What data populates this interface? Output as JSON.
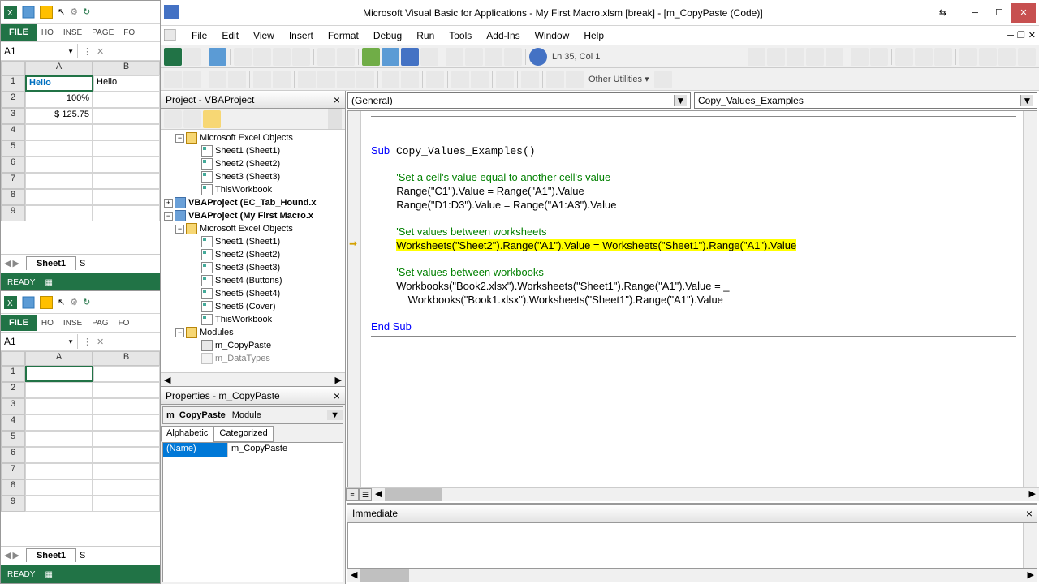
{
  "excel1": {
    "file_tab": "FILE",
    "ribbon_tabs": [
      "HO",
      "INSE",
      "PAGE",
      "FO"
    ],
    "name_box": "A1",
    "cols": [
      "A",
      "B"
    ],
    "b1": "Hello",
    "rows": {
      "1": "Hello",
      "2": "100%",
      "3": "$ 125.75"
    },
    "sheet": "Sheet1",
    "sheet2_partial": "S",
    "status": "READY"
  },
  "excel2": {
    "file_tab": "FILE",
    "ribbon_tabs": [
      "HO",
      "INSE",
      "PAG",
      "FO"
    ],
    "name_box": "A1",
    "cols": [
      "A",
      "B"
    ],
    "sheet": "Sheet1",
    "sheet2_partial": "S",
    "status": "READY"
  },
  "vbe": {
    "title": "Microsoft Visual Basic for Applications - My First Macro.xlsm [break] - [m_CopyPaste (Code)]",
    "menus": [
      "File",
      "Edit",
      "View",
      "Insert",
      "Format",
      "Debug",
      "Run",
      "Tools",
      "Add-Ins",
      "Window",
      "Help"
    ],
    "cursor_pos": "Ln 35, Col 1",
    "other_utils": "Other Utilities",
    "project": {
      "title": "Project - VBAProject",
      "nodes": {
        "meo1": "Microsoft Excel Objects",
        "s1": "Sheet1 (Sheet1)",
        "s2": "Sheet2 (Sheet2)",
        "s3": "Sheet3 (Sheet3)",
        "tw": "ThisWorkbook",
        "proj1": "VBAProject (EC_Tab_Hound.x",
        "proj2": "VBAProject (My First Macro.x",
        "meo2": "Microsoft Excel Objects",
        "p2s1": "Sheet1 (Sheet1)",
        "p2s2": "Sheet2 (Sheet2)",
        "p2s3": "Sheet3 (Sheet3)",
        "p2s4": "Sheet4 (Buttons)",
        "p2s5": "Sheet5 (Sheet4)",
        "p2s6": "Sheet6 (Cover)",
        "p2tw": "ThisWorkbook",
        "modules": "Modules",
        "mod1": "m_CopyPaste",
        "mod2": "m_DataTypes"
      }
    },
    "properties": {
      "title": "Properties - m_CopyPaste",
      "combo_name": "m_CopyPaste",
      "combo_type": "Module",
      "tab_alpha": "Alphabetic",
      "tab_cat": "Categorized",
      "row_name": "(Name)",
      "row_value": "m_CopyPaste"
    },
    "code": {
      "dd_left": "(General)",
      "dd_right": "Copy_Values_Examples",
      "sub_line": "Sub Copy_Values_Examples()",
      "c1": "'Set a cell's value equal to another cell's value",
      "l1": "Range(\"C1\").Value = Range(\"A1\").Value",
      "l2": "Range(\"D1:D3\").Value = Range(\"A1:A3\").Value",
      "c2": "'Set values between worksheets",
      "hl": "Worksheets(\"Sheet2\").Range(\"A1\").Value = Worksheets(\"Sheet1\").Range(\"A1\").Value",
      "c3": "'Set values between workbooks",
      "l3": "Workbooks(\"Book2.xlsx\").Worksheets(\"Sheet1\").Range(\"A1\").Value = _",
      "l4": "    Workbooks(\"Book1.xlsx\").Worksheets(\"Sheet1\").Range(\"A1\").Value",
      "end": "End Sub"
    },
    "immediate": {
      "title": "Immediate"
    }
  }
}
